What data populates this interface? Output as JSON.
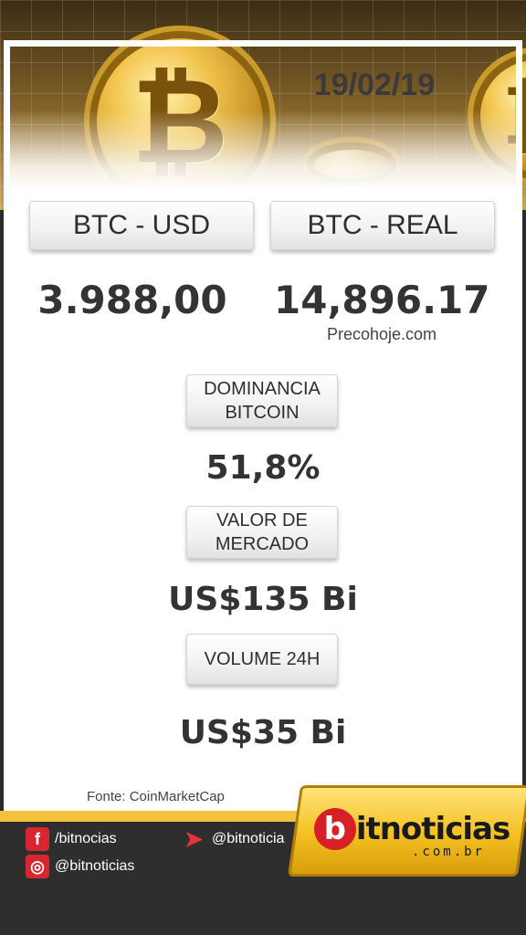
{
  "header": {
    "date": "19/02/19"
  },
  "btc_usd": {
    "label": "BTC - USD",
    "value": "3.988,00"
  },
  "btc_real": {
    "label": "BTC - REAL",
    "value": "14,896.17",
    "source": "Precohoje.com"
  },
  "dominance": {
    "label_line1": "DOMINANCIA",
    "label_line2": "BITCOIN",
    "value": "51,8%"
  },
  "market_cap": {
    "label_line1": "VALOR DE",
    "label_line2": "MERCADO",
    "value": "US$135 Bi"
  },
  "volume": {
    "label": "VOLUME 24H",
    "value": "US$35 Bi"
  },
  "source_note": "Fonte: CoinMarketCap",
  "social": {
    "facebook": "/bitnocias",
    "telegram": "@bitnoticia",
    "instagram": "@bitnoticias"
  },
  "brand": {
    "letter": "b",
    "name": "itnoticias",
    "domain": ".com.br"
  },
  "colors": {
    "accent_yellow": "#f3c23a",
    "brand_red": "#d61f26",
    "footer_bg": "#2e2e2e"
  }
}
